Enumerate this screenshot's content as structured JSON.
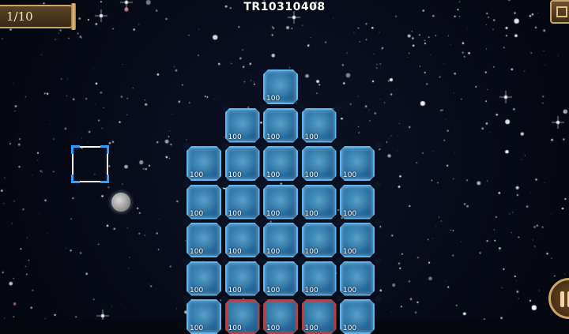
{
  "hud": {
    "turn_counter": "1/10",
    "stage_id": "TR10310408"
  },
  "board": {
    "tile_value": "100",
    "tiles": [
      {
        "col": 2,
        "row": 0,
        "kind": "ice"
      },
      {
        "col": 1,
        "row": 1,
        "kind": "ice"
      },
      {
        "col": 2,
        "row": 1,
        "kind": "ice"
      },
      {
        "col": 3,
        "row": 1,
        "kind": "ice"
      },
      {
        "col": 0,
        "row": 2,
        "kind": "ice"
      },
      {
        "col": 1,
        "row": 2,
        "kind": "ice"
      },
      {
        "col": 2,
        "row": 2,
        "kind": "ice"
      },
      {
        "col": 3,
        "row": 2,
        "kind": "ice"
      },
      {
        "col": 4,
        "row": 2,
        "kind": "ice"
      },
      {
        "col": 0,
        "row": 3,
        "kind": "ice"
      },
      {
        "col": 1,
        "row": 3,
        "kind": "ice"
      },
      {
        "col": 2,
        "row": 3,
        "kind": "ice"
      },
      {
        "col": 3,
        "row": 3,
        "kind": "ice"
      },
      {
        "col": 4,
        "row": 3,
        "kind": "ice"
      },
      {
        "col": 0,
        "row": 4,
        "kind": "ice"
      },
      {
        "col": 1,
        "row": 4,
        "kind": "ice"
      },
      {
        "col": 2,
        "row": 4,
        "kind": "ice"
      },
      {
        "col": 3,
        "row": 4,
        "kind": "ice"
      },
      {
        "col": 4,
        "row": 4,
        "kind": "ice"
      },
      {
        "col": 0,
        "row": 5,
        "kind": "ice"
      },
      {
        "col": 1,
        "row": 5,
        "kind": "ice"
      },
      {
        "col": 2,
        "row": 5,
        "kind": "ice"
      },
      {
        "col": 3,
        "row": 5,
        "kind": "ice"
      },
      {
        "col": 4,
        "row": 5,
        "kind": "ice"
      },
      {
        "col": 0,
        "row": 6,
        "kind": "ice"
      },
      {
        "col": 1,
        "row": 6,
        "kind": "red"
      },
      {
        "col": 2,
        "row": 6,
        "kind": "red"
      },
      {
        "col": 3,
        "row": 6,
        "kind": "red"
      },
      {
        "col": 4,
        "row": 6,
        "kind": "ice"
      }
    ]
  },
  "icons": {
    "menu": "corner-menu-icon",
    "pause": "pause-icon",
    "selector": "selection-cursor",
    "orb": "orb"
  },
  "colors": {
    "tile_border": "#5fb6ee",
    "blocked_border": "#c83a3a",
    "hud_gold": "#c8a66a",
    "space_bg": "#05070f"
  }
}
